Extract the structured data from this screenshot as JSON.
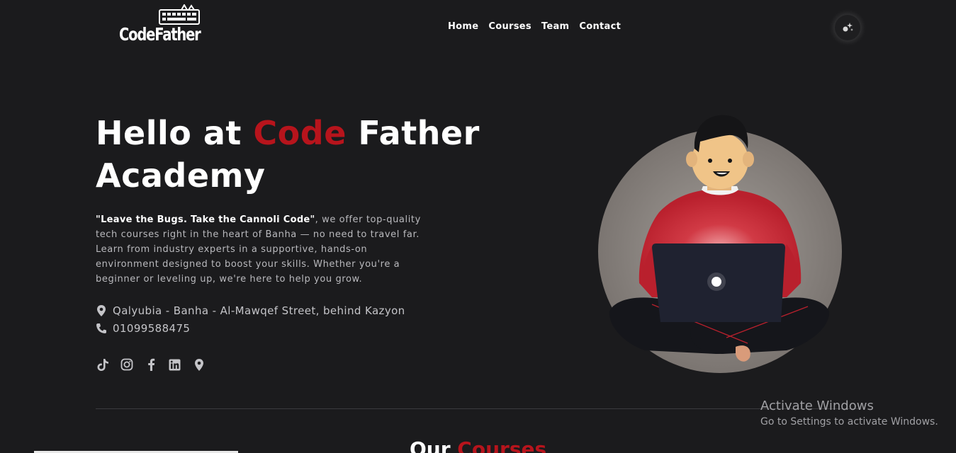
{
  "brand": {
    "logo_text": "CodeFather"
  },
  "nav": {
    "items": [
      "Home",
      "Courses",
      "Team",
      "Contact"
    ]
  },
  "theme_toggle": {
    "icon": "sparkles-icon"
  },
  "hero": {
    "title_part1": "Hello at ",
    "title_accent": "Code",
    "title_part2": " Father",
    "title_line2": "Academy",
    "quote": "\"Leave the Bugs. Take the Cannoli Code\"",
    "description": ", we offer top-quality tech courses right in the heart of Banha — no need to travel far. Learn from industry experts in a supportive, hands-on environment designed to boost your skills. Whether you're a beginner or leveling up, we're here to help you grow.",
    "address": "Qalyubia - Banha - Al-Mawqef Street, behind Kazyon",
    "phone": "01099588475"
  },
  "social": [
    "tiktok-icon",
    "instagram-icon",
    "facebook-icon",
    "linkedin-icon",
    "location-icon"
  ],
  "courses_section": {
    "title_part1": "Our ",
    "title_accent": "Courses"
  },
  "watermark": {
    "line1": "Activate Windows",
    "line2": "Go to Settings to activate Windows."
  },
  "colors": {
    "background": "#1b1b1d",
    "accent": "#b7141c",
    "text_muted": "#b9b9bd"
  }
}
